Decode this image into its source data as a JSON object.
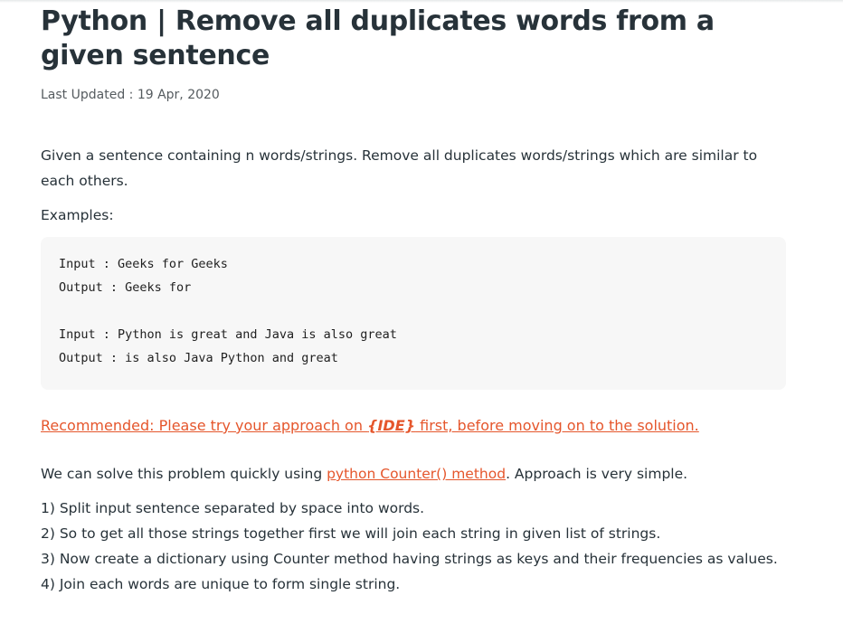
{
  "article": {
    "title": "Python | Remove all duplicates words from a given sentence",
    "last_updated": "Last Updated : 19 Apr, 2020",
    "intro": "Given a sentence containing n words/strings. Remove all duplicates words/strings which are similar to each others.",
    "examples_label": "Examples:",
    "code_lines": [
      "Input : Geeks for Geeks",
      "Output : Geeks for",
      "Input : Python is great and Java is also great",
      "Output : is also Java Python and great"
    ],
    "recommended": {
      "prefix": "Recommended: Please try your approach on ",
      "ide_label": "{IDE}",
      "suffix": " first, before moving on to the solution."
    },
    "solve": {
      "before": "We can solve this problem quickly using ",
      "link": "python Counter() method",
      "after": ". Approach is very simple."
    },
    "steps": [
      "1) Split input sentence separated by space into words.",
      "2) So to get all those strings together first we will join each string in given list of strings.",
      "3) Now create a dictionary using Counter method having strings as keys and their frequencies as values.",
      "4) Join each words are unique to form single string."
    ]
  },
  "colors": {
    "text": "#273239",
    "link": "#e5562c",
    "code_bg": "#f7f7f7"
  }
}
